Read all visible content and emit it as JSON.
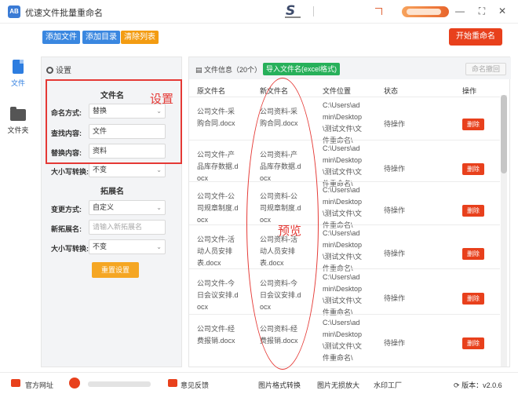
{
  "window": {
    "title": "优速文件批量重命名",
    "logo_text": "AB",
    "center_logo": "S",
    "minimize": "—",
    "restore": "⛶",
    "close": "✕"
  },
  "toolbar": {
    "add_file": "添加文件",
    "add_dir": "添加目录",
    "clear_list": "清除列表",
    "start_rename": "开始重命名"
  },
  "nav": {
    "items": [
      {
        "label": "文件",
        "icon": "document-icon",
        "active": true
      },
      {
        "label": "文件夹",
        "icon": "folder-icon",
        "active": false
      }
    ]
  },
  "settings": {
    "header": "设置",
    "filename_section": "文件名",
    "naming_mode_label": "命名方式:",
    "naming_mode_value": "替换",
    "find_label": "查找内容:",
    "find_value": "文件",
    "replace_label": "替换内容:",
    "replace_value": "资料",
    "case_label": "大小写转换:",
    "case_value": "不变",
    "ext_section": "拓展名",
    "change_mode_label": "变更方式:",
    "change_mode_value": "自定义",
    "new_ext_label": "新拓展名:",
    "new_ext_placeholder": "请输入新拓展名",
    "ext_case_label": "大小写转换:",
    "ext_case_value": "不变",
    "reset": "重置设置"
  },
  "annotations": {
    "settings": "设置",
    "preview": "预览"
  },
  "file_panel": {
    "info": "文件信息（20个）",
    "import_btn": "导入文件名(excel格式)",
    "rollback": "命名撤回",
    "columns": [
      "原文件名",
      "新文件名",
      "文件位置",
      "状态",
      "操作"
    ],
    "rows": [
      {
        "orig": [
          "公司文件-采",
          "购合同.docx"
        ],
        "new": [
          "公司资料-采",
          "购合同.docx"
        ],
        "loc": [
          "C:\\Users\\ad",
          "min\\Desktop",
          "\\测试文件\\文",
          "件重命名\\"
        ],
        "status": "待操作",
        "action": "删除"
      },
      {
        "orig": [
          "公司文件-产",
          "品库存数据.d",
          "ocx"
        ],
        "new": [
          "公司资料-产",
          "品库存数据.d",
          "ocx"
        ],
        "loc": [
          "C:\\Users\\ad",
          "min\\Desktop",
          "\\测试文件\\文",
          "件重命名\\"
        ],
        "status": "待操作",
        "action": "删除"
      },
      {
        "orig": [
          "公司文件-公",
          "司规章制度.d",
          "ocx"
        ],
        "new": [
          "公司资料-公",
          "司规章制度.d",
          "ocx"
        ],
        "loc": [
          "C:\\Users\\ad",
          "min\\Desktop",
          "\\测试文件\\文",
          "件重命名\\"
        ],
        "status": "待操作",
        "action": "删除"
      },
      {
        "orig": [
          "公司文件-活",
          "动人员安排",
          "表.docx"
        ],
        "new": [
          "公司资料-活",
          "动人员安排",
          "表.docx"
        ],
        "loc": [
          "C:\\Users\\ad",
          "min\\Desktop",
          "\\测试文件\\文",
          "件重命名\\"
        ],
        "status": "待操作",
        "action": "删除"
      },
      {
        "orig": [
          "公司文件-今",
          "日会议安排.d",
          "ocx"
        ],
        "new": [
          "公司资料-今",
          "日会议安排.d",
          "ocx"
        ],
        "loc": [
          "C:\\Users\\ad",
          "min\\Desktop",
          "\\测试文件\\文",
          "件重命名\\"
        ],
        "status": "待操作",
        "action": "删除"
      },
      {
        "orig": [
          "公司文件-经",
          "费报销.docx"
        ],
        "new": [
          "公司资料-经",
          "费报销.docx"
        ],
        "loc": [
          "C:\\Users\\ad",
          "min\\Desktop",
          "\\测试文件\\文",
          "件重命名\\"
        ],
        "status": "待操作",
        "action": "删除"
      }
    ]
  },
  "footer": {
    "website": "官方网址",
    "feedback": "意见反馈",
    "img_convert": "图片格式转换",
    "img_enlarge": "图片无损放大",
    "watermark": "水印工厂",
    "version": "版本：v2.0.6"
  }
}
